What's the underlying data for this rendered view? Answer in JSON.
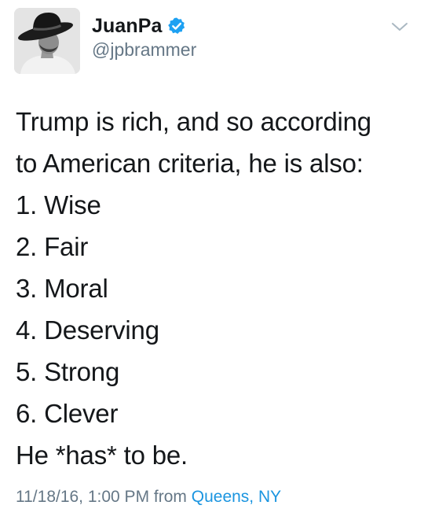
{
  "author": {
    "display_name": "JuanPa",
    "handle": "@jpbrammer",
    "verified": true
  },
  "icons": {
    "verified": "verified-badge-icon",
    "menu": "chevron-down-icon"
  },
  "tweet": {
    "lines": [
      "Trump is rich, and so according",
      "to American criteria, he is also:",
      "1. Wise",
      "2. Fair",
      "3. Moral",
      "4. Deserving",
      "5. Strong",
      "6. Clever",
      "He *has* to be."
    ]
  },
  "meta": {
    "timestamp": "11/18/16, 1:00 PM",
    "from_label": "from",
    "location": "Queens, NY"
  },
  "colors": {
    "text": "#14171a",
    "secondary": "#657786",
    "link": "#1b95e0",
    "verified": "#1da1f2"
  }
}
